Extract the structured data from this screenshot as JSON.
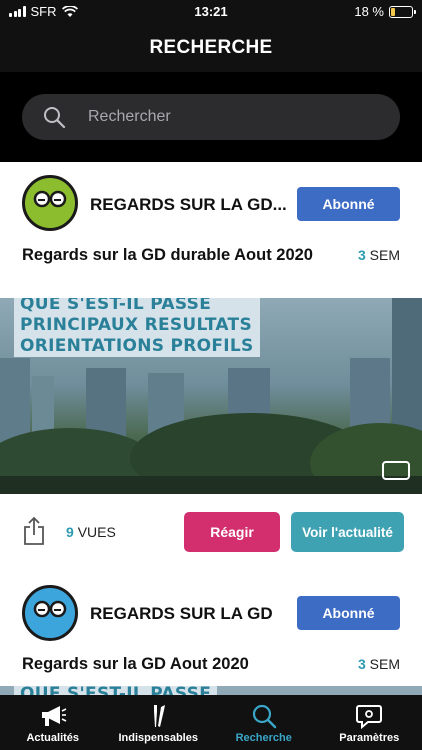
{
  "status_bar": {
    "carrier": "SFR",
    "time": "13:21",
    "battery": "18 %",
    "battery_level": 0.18
  },
  "header": {
    "title": "RECHERCHE"
  },
  "search": {
    "placeholder": "Rechercher"
  },
  "cards": [
    {
      "source_name": "REGARDS SUR LA GD...",
      "subscribe_label": "Abonné",
      "avatar_color": "#8cbd2e",
      "article_title": "Regards sur la GD durable Aout 2020",
      "age_value": "3",
      "age_unit": "SEM",
      "headline": [
        "QUE S'EST-IL PASSE",
        "PRINCIPAUX RESULTATS",
        "ORIENTATIONS PROFILS"
      ],
      "views_value": "9",
      "views_unit": "VUES",
      "react_label": "Réagir",
      "view_label": "Voir l'actualité"
    },
    {
      "source_name": "REGARDS SUR LA GD",
      "subscribe_label": "Abonné",
      "avatar_color": "#3ca6dc",
      "article_title": "Regards sur la GD Aout 2020",
      "age_value": "3",
      "age_unit": "SEM",
      "headline": [
        "QUE S'EST-IL PASSE"
      ]
    }
  ],
  "tabs": [
    {
      "label": "Actualités",
      "icon": "megaphone-icon",
      "active": false
    },
    {
      "label": "Indispensables",
      "icon": "tools-icon",
      "active": false
    },
    {
      "label": "Recherche",
      "icon": "search-icon",
      "active": true
    },
    {
      "label": "Paramètres",
      "icon": "chat-settings-icon",
      "active": false
    }
  ],
  "colors": {
    "accent": "#3aa6c8",
    "subscribe": "#3d6cc5",
    "react": "#d32f6f",
    "view": "#3fa2b3",
    "headline_text": "#2a8098"
  }
}
